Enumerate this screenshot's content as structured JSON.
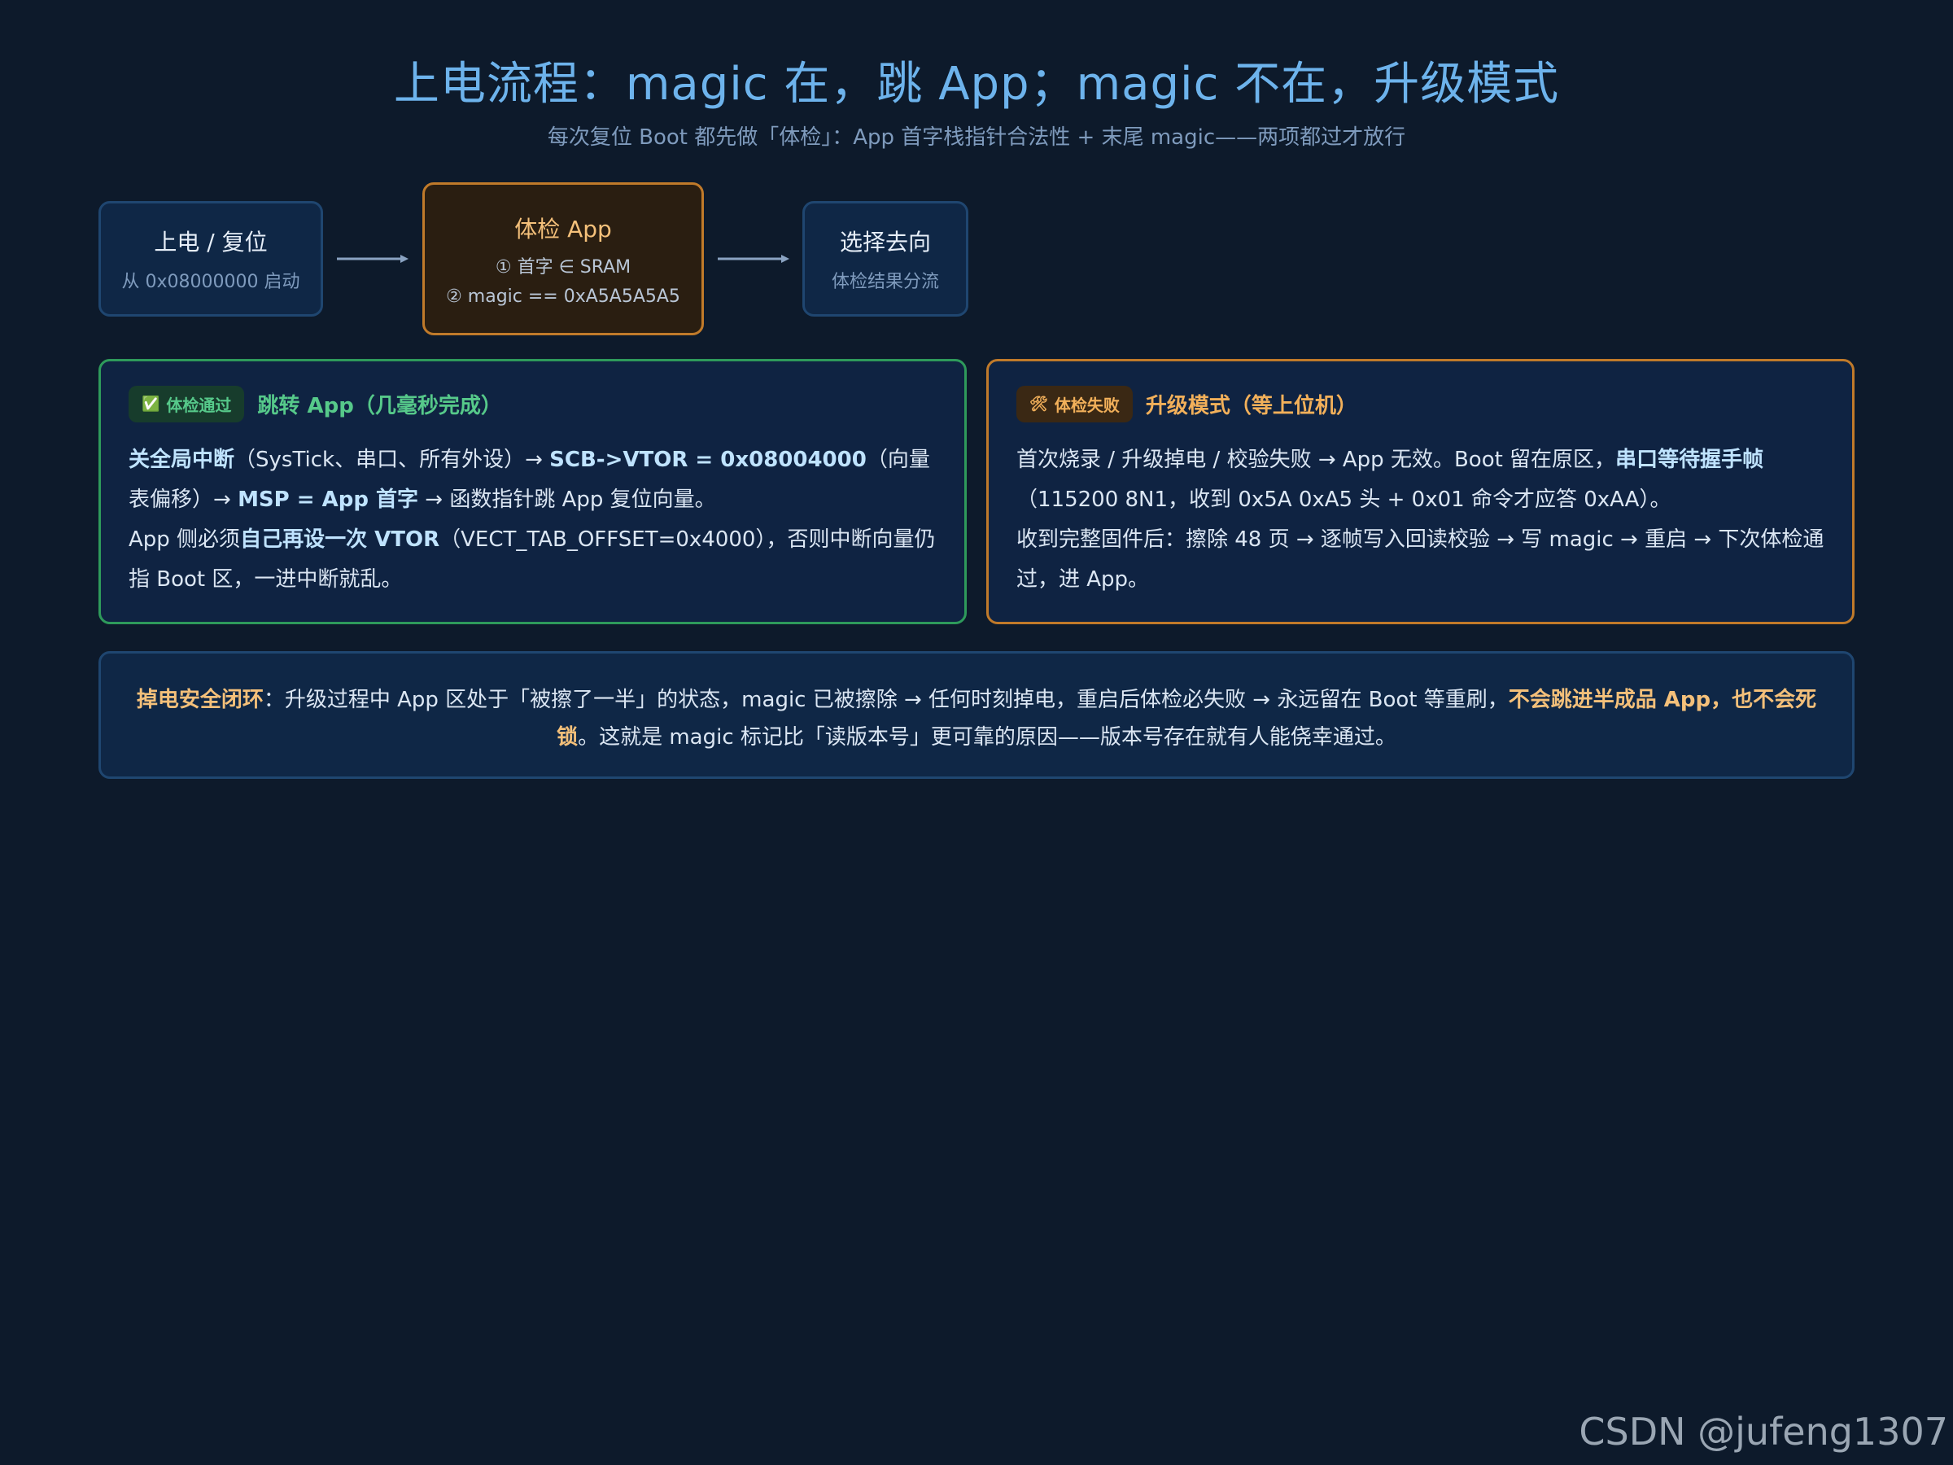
{
  "header": {
    "title": "上电流程：magic 在，跳 App；magic 不在，升级模式",
    "subtitle": "每次复位 Boot 都先做「体检」：App 首字栈指针合法性 + 末尾 magic——两项都过才放行"
  },
  "flow": {
    "nodes": [
      {
        "title": "上电 / 复位",
        "lines": [
          "从 0x08000000 启动"
        ]
      },
      {
        "title": "体检 App",
        "lines": [
          "① 首字 ∈ SRAM",
          "② magic == 0xA5A5A5A5"
        ]
      },
      {
        "title": "选择去向",
        "lines": [
          "体检结果分流"
        ]
      }
    ]
  },
  "pass_card": {
    "badge": "体检通过",
    "badge_icon": "check-box-icon",
    "title": "跳转 App（几毫秒完成）",
    "p1": [
      "关全局中断",
      "（SysTick、串口、所有外设）→ ",
      "SCB->VTOR = 0x08004000",
      "（向量表偏移）→ ",
      "MSP = App 首字",
      " → 函数指针跳 App 复位向量。"
    ],
    "p2": [
      "App 侧必须",
      "自己再设一次 VTOR",
      "（VECT_TAB_OFFSET=0x4000），否则中断向量仍指 Boot 区，一进中断就乱。"
    ]
  },
  "fail_card": {
    "badge": "体检失败",
    "badge_icon": "tools-icon",
    "title": "升级模式（等上位机）",
    "p1": [
      "首次烧录 / 升级掉电 / 校验失败 → App 无效。Boot 留在原区，",
      "串口等待握手帧",
      "（115200 8N1，收到 0x5A 0xA5 头 + 0x01 命令才应答 0xAA）。"
    ],
    "p2": [
      "收到完整固件后：擦除 48 页 → 逐帧写入回读校验 → 写 magic → 重启 → 下次体检通过，进 App。"
    ]
  },
  "note": {
    "parts": [
      "掉电安全闭环",
      "：升级过程中 App 区处于「被擦了一半」的状态，magic 已被擦除 → 任何时刻掉电，重启后体检必失败 → 永远留在 Boot 等重刷，",
      "不会跳进半成品 App，也不会死锁",
      "。这就是 magic 标记比「读版本号」更可靠的原因——版本号存在就有人能侥幸通过。"
    ]
  },
  "watermark": "CSDN @jufeng1307"
}
